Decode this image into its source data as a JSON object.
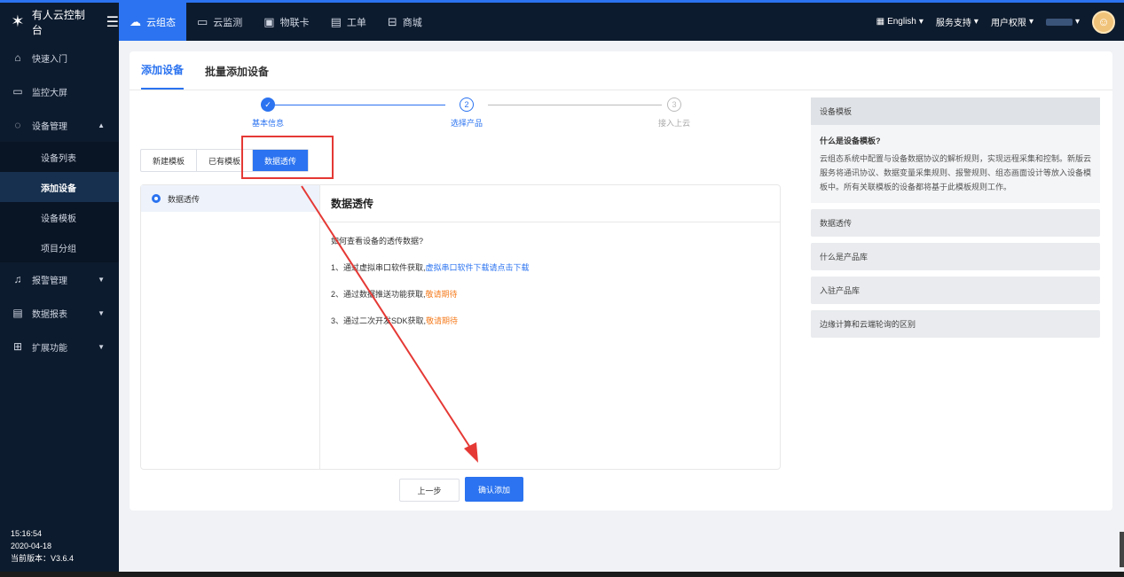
{
  "brand": {
    "title": "有人云控制台"
  },
  "topnav": [
    {
      "label": "云组态",
      "icon": "cloud-icon",
      "active": true
    },
    {
      "label": "云监测",
      "icon": "monitor-icon"
    },
    {
      "label": "物联卡",
      "icon": "sim-card-icon"
    },
    {
      "label": "工单",
      "icon": "ticket-icon"
    },
    {
      "label": "商城",
      "icon": "shop-icon"
    }
  ],
  "topright": {
    "language": "English",
    "support": "服务支持",
    "permissions": "用户权限"
  },
  "sidebar": {
    "items": [
      {
        "label": "快速入门",
        "icon": "home-icon"
      },
      {
        "label": "监控大屏",
        "icon": "screen-icon"
      },
      {
        "label": "设备管理",
        "icon": "device-icon"
      }
    ],
    "sub": [
      "设备列表",
      "添加设备",
      "设备模板",
      "项目分组"
    ],
    "items2": [
      {
        "label": "报警管理",
        "icon": "bell-icon"
      },
      {
        "label": "数据报表",
        "icon": "report-icon"
      },
      {
        "label": "扩展功能",
        "icon": "grid-icon"
      }
    ],
    "footer": {
      "time": "15:16:54",
      "date": "2020-04-18",
      "version": "当前版本：V3.6.4"
    }
  },
  "tabs": {
    "add": "添加设备",
    "batch": "批量添加设备"
  },
  "steps": [
    {
      "num": "✓",
      "label": "基本信息"
    },
    {
      "num": "2",
      "label": "选择产品"
    },
    {
      "num": "3",
      "label": "接入上云"
    }
  ],
  "template_buttons": {
    "new": "新建模板",
    "existing": "已有模板",
    "passthrough": "数据透传"
  },
  "panel": {
    "left_item": "数据透传",
    "title": "数据透传",
    "question": "如何查看设备的透传数据?",
    "line1": "1、通过虚拟串口软件获取,",
    "line1_link": "虚拟串口软件下载请点击下载",
    "line2": "2、通过数据推送功能获取,",
    "line2_link": "敬请期待",
    "line3": "3、通过二次开发SDK获取,",
    "line3_link": "敬请期待"
  },
  "buttons": {
    "prev": "上一步",
    "confirm": "确认添加"
  },
  "help": {
    "title1": "设备模板",
    "question": "什么是设备模板?",
    "answer": "云组态系统中配置与设备数据协议的解析规则，实现远程采集和控制。新版云服务将通讯协议、数据变量采集规则、报警规则、组态画面设计等放入设备模板中。所有关联模板的设备都将基于此模板规则工作。",
    "title2": "数据透传",
    "title3": "什么是产品库",
    "title4": "入驻产品库",
    "title5": "边缘计算和云端轮询的区别"
  }
}
